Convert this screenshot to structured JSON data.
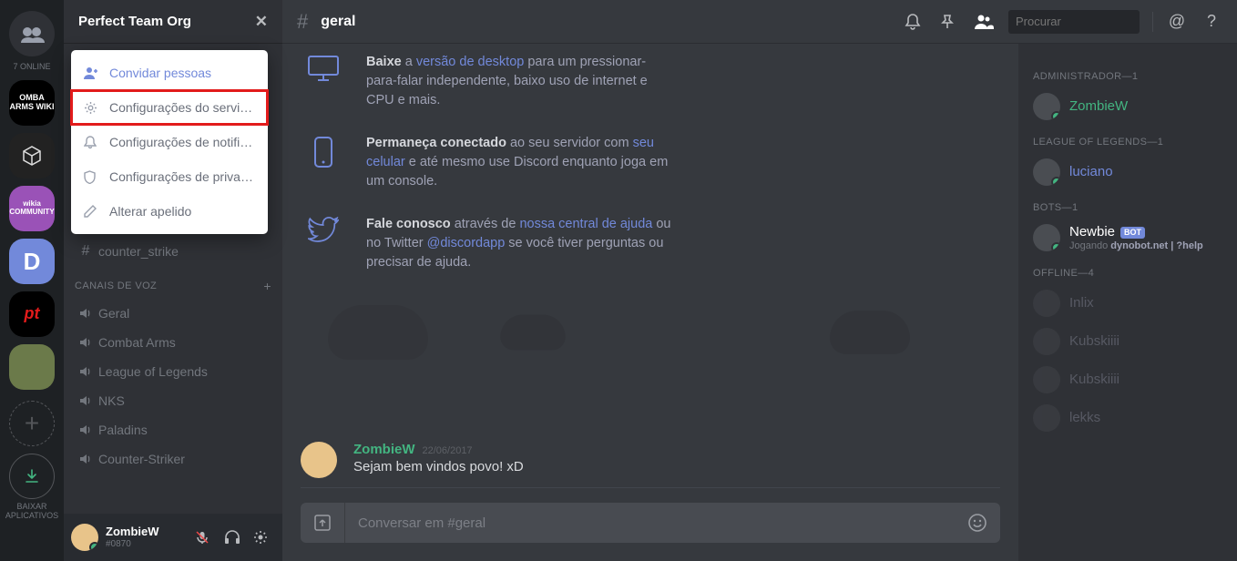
{
  "guilds": {
    "online_label": "7 ONLINE",
    "items": [
      {
        "name": "Home",
        "label": ""
      },
      {
        "name": "Omba Arms Wiki",
        "label": "OMBA ARMS WIKI"
      },
      {
        "name": "Loot",
        "label": ""
      },
      {
        "name": "Wikia Community",
        "label": "wikia COMMUNITY"
      },
      {
        "name": "Discord",
        "label": "D"
      },
      {
        "name": "PT",
        "label": "pt"
      },
      {
        "name": "Game",
        "label": ""
      }
    ],
    "download_label": "BAIXAR APLICATIVOS"
  },
  "serverHeader": {
    "name": "Perfect Team Org"
  },
  "dropdown": {
    "invite": "Convidar pessoas",
    "server_settings": "Configurações do servi…",
    "notif_settings": "Configurações de notifi…",
    "priv_settings": "Configurações de priva…",
    "nickname": "Alterar apelido"
  },
  "channels": {
    "text": [
      {
        "name": "counter_strike"
      }
    ],
    "voice_header": "CANAIS DE VOZ",
    "voice": [
      {
        "name": "Geral"
      },
      {
        "name": "Combat Arms"
      },
      {
        "name": "League of Legends"
      },
      {
        "name": "NKS"
      },
      {
        "name": "Paladins"
      },
      {
        "name": "Counter-Striker"
      }
    ]
  },
  "userPanel": {
    "name": "ZombieW",
    "discrim": "#0870"
  },
  "topbar": {
    "channel": "geral",
    "search_placeholder": "Procurar"
  },
  "welcome": {
    "rows": [
      {
        "bold": "Baixe",
        "text1": " a ",
        "link1": "versão de desktop",
        "text2": " para um pressionar-para-falar independente, baixo uso de internet e CPU e mais."
      },
      {
        "bold": "Permaneça conectado",
        "text1": " ao seu servidor com ",
        "link1": "seu celular",
        "text2": " e até mesmo use Discord enquanto joga em um console."
      },
      {
        "bold": "Fale conosco",
        "text1": " através de ",
        "link1": "nossa central de ajuda",
        "text2": " ou no Twitter ",
        "link2": "@discordapp",
        "text3": " se você tiver perguntas ou precisar de ajuda."
      }
    ]
  },
  "message": {
    "author": "ZombieW",
    "timestamp": "22/06/2017",
    "content": "Sejam bem vindos povo! xD"
  },
  "input_placeholder": "Conversar em #geral",
  "members": {
    "groups": [
      {
        "title": "ADMINISTRADOR—1",
        "items": [
          {
            "name": "ZombieW",
            "color": "#43b581",
            "status": "online"
          }
        ]
      },
      {
        "title": "LEAGUE OF LEGENDS—1",
        "items": [
          {
            "name": "luciano",
            "color": "#7289da",
            "status": "online"
          }
        ]
      },
      {
        "title": "BOTS—1",
        "items": [
          {
            "name": "Newbie",
            "color": "#ffffff",
            "status": "online",
            "bot": true,
            "activity_prefix": "Jogando ",
            "activity_bold": "dynobot.net | ?help"
          }
        ]
      },
      {
        "title": "OFFLINE—4",
        "items": [
          {
            "name": "Inlix",
            "color": "#9fa2b5",
            "status": "offline"
          },
          {
            "name": "Kubskiiii",
            "color": "#9fa2b5",
            "status": "offline"
          },
          {
            "name": "Kubskiiii",
            "color": "#9fa2b5",
            "status": "offline"
          },
          {
            "name": "lekks",
            "color": "#9fa2b5",
            "status": "offline"
          }
        ]
      }
    ]
  }
}
